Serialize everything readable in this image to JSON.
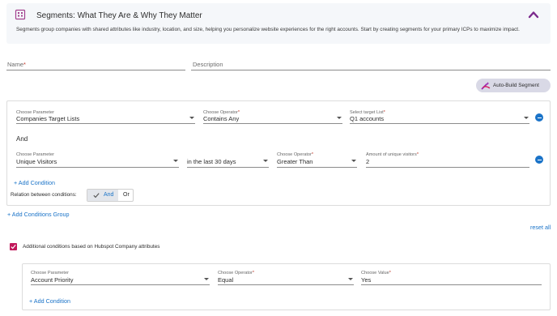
{
  "info": {
    "title": "Segments: What They Are & Why They Matter",
    "text": "Segments group companies with shared attributes like industry, location, and size, helping you personalize website experiences for the right accounts. Start by creating segments for your primary ICPs to maximize impact."
  },
  "form": {
    "name_label": "Name",
    "required_mark": "*",
    "description_label": "Description"
  },
  "auto_build": {
    "label": "Auto-Build Segment"
  },
  "group": {
    "row1": [
      {
        "label": "Choose Parameter",
        "required": "",
        "value": "Companies Target Lists"
      },
      {
        "label": "Choose Operator",
        "required": "*",
        "value": "Contains Any"
      },
      {
        "label": "Select target List",
        "required": "*",
        "value": "Q1 accounts"
      }
    ],
    "and_text": "And",
    "row2": [
      {
        "label": "Choose Parameter",
        "required": "",
        "value": "Unique Visitors"
      },
      {
        "label": "",
        "required": "",
        "value": "in the last 30 days"
      },
      {
        "label": "Choose Operator",
        "required": "*",
        "value": "Greater Than"
      },
      {
        "label": "Amount of unique visitors",
        "required": "*",
        "value": "2"
      }
    ],
    "add_condition": "+ Add Condition",
    "relation_label": "Relation between conditions:",
    "relation_options": [
      "And",
      "Or"
    ],
    "relation_selected": "And"
  },
  "add_group": "+ Add Conditions Group",
  "reset_all": "reset all",
  "additional": {
    "checked": true,
    "label": "Additional conditions based on Hubspot Company attributes",
    "row": [
      {
        "label": "Choose Parameter",
        "required": "",
        "value": "Account Priority"
      },
      {
        "label": "Choose Operator",
        "required": "*",
        "value": "Equal"
      },
      {
        "label": "Choose Value",
        "required": "*",
        "value": "Yes"
      }
    ],
    "add_condition": "+ Add Condition"
  },
  "colors": {
    "accent": "#1a73c8",
    "brand": "#7b2a8c",
    "checkbox": "#c2185b",
    "panel_bg": "#f5f7fa"
  },
  "icons": {
    "info": "building-grid-icon",
    "collapse": "chevron-up-icon",
    "auto_build": "magic-wand-icon",
    "remove": "minus-circle-icon",
    "check": "check-icon"
  }
}
